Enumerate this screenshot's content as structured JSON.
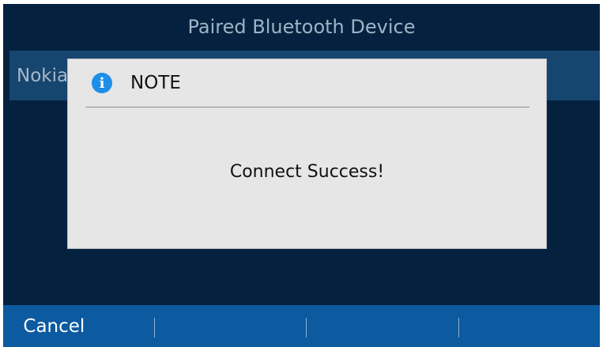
{
  "header": {
    "title": "Paired Bluetooth Device"
  },
  "device_list": {
    "items": [
      {
        "label": "Nokia"
      }
    ]
  },
  "dialog": {
    "icon": "info-icon",
    "title": "NOTE",
    "message": "Connect Success!"
  },
  "softkeys": [
    {
      "label": "Cancel"
    },
    {
      "label": ""
    },
    {
      "label": ""
    },
    {
      "label": ""
    }
  ],
  "colors": {
    "screen_bg": "#042240",
    "row_highlight": "#16456f",
    "dialog_bg": "#e6e6e6",
    "info_icon": "#1e8fe8",
    "softkey_bar": "#0c5aa0"
  }
}
